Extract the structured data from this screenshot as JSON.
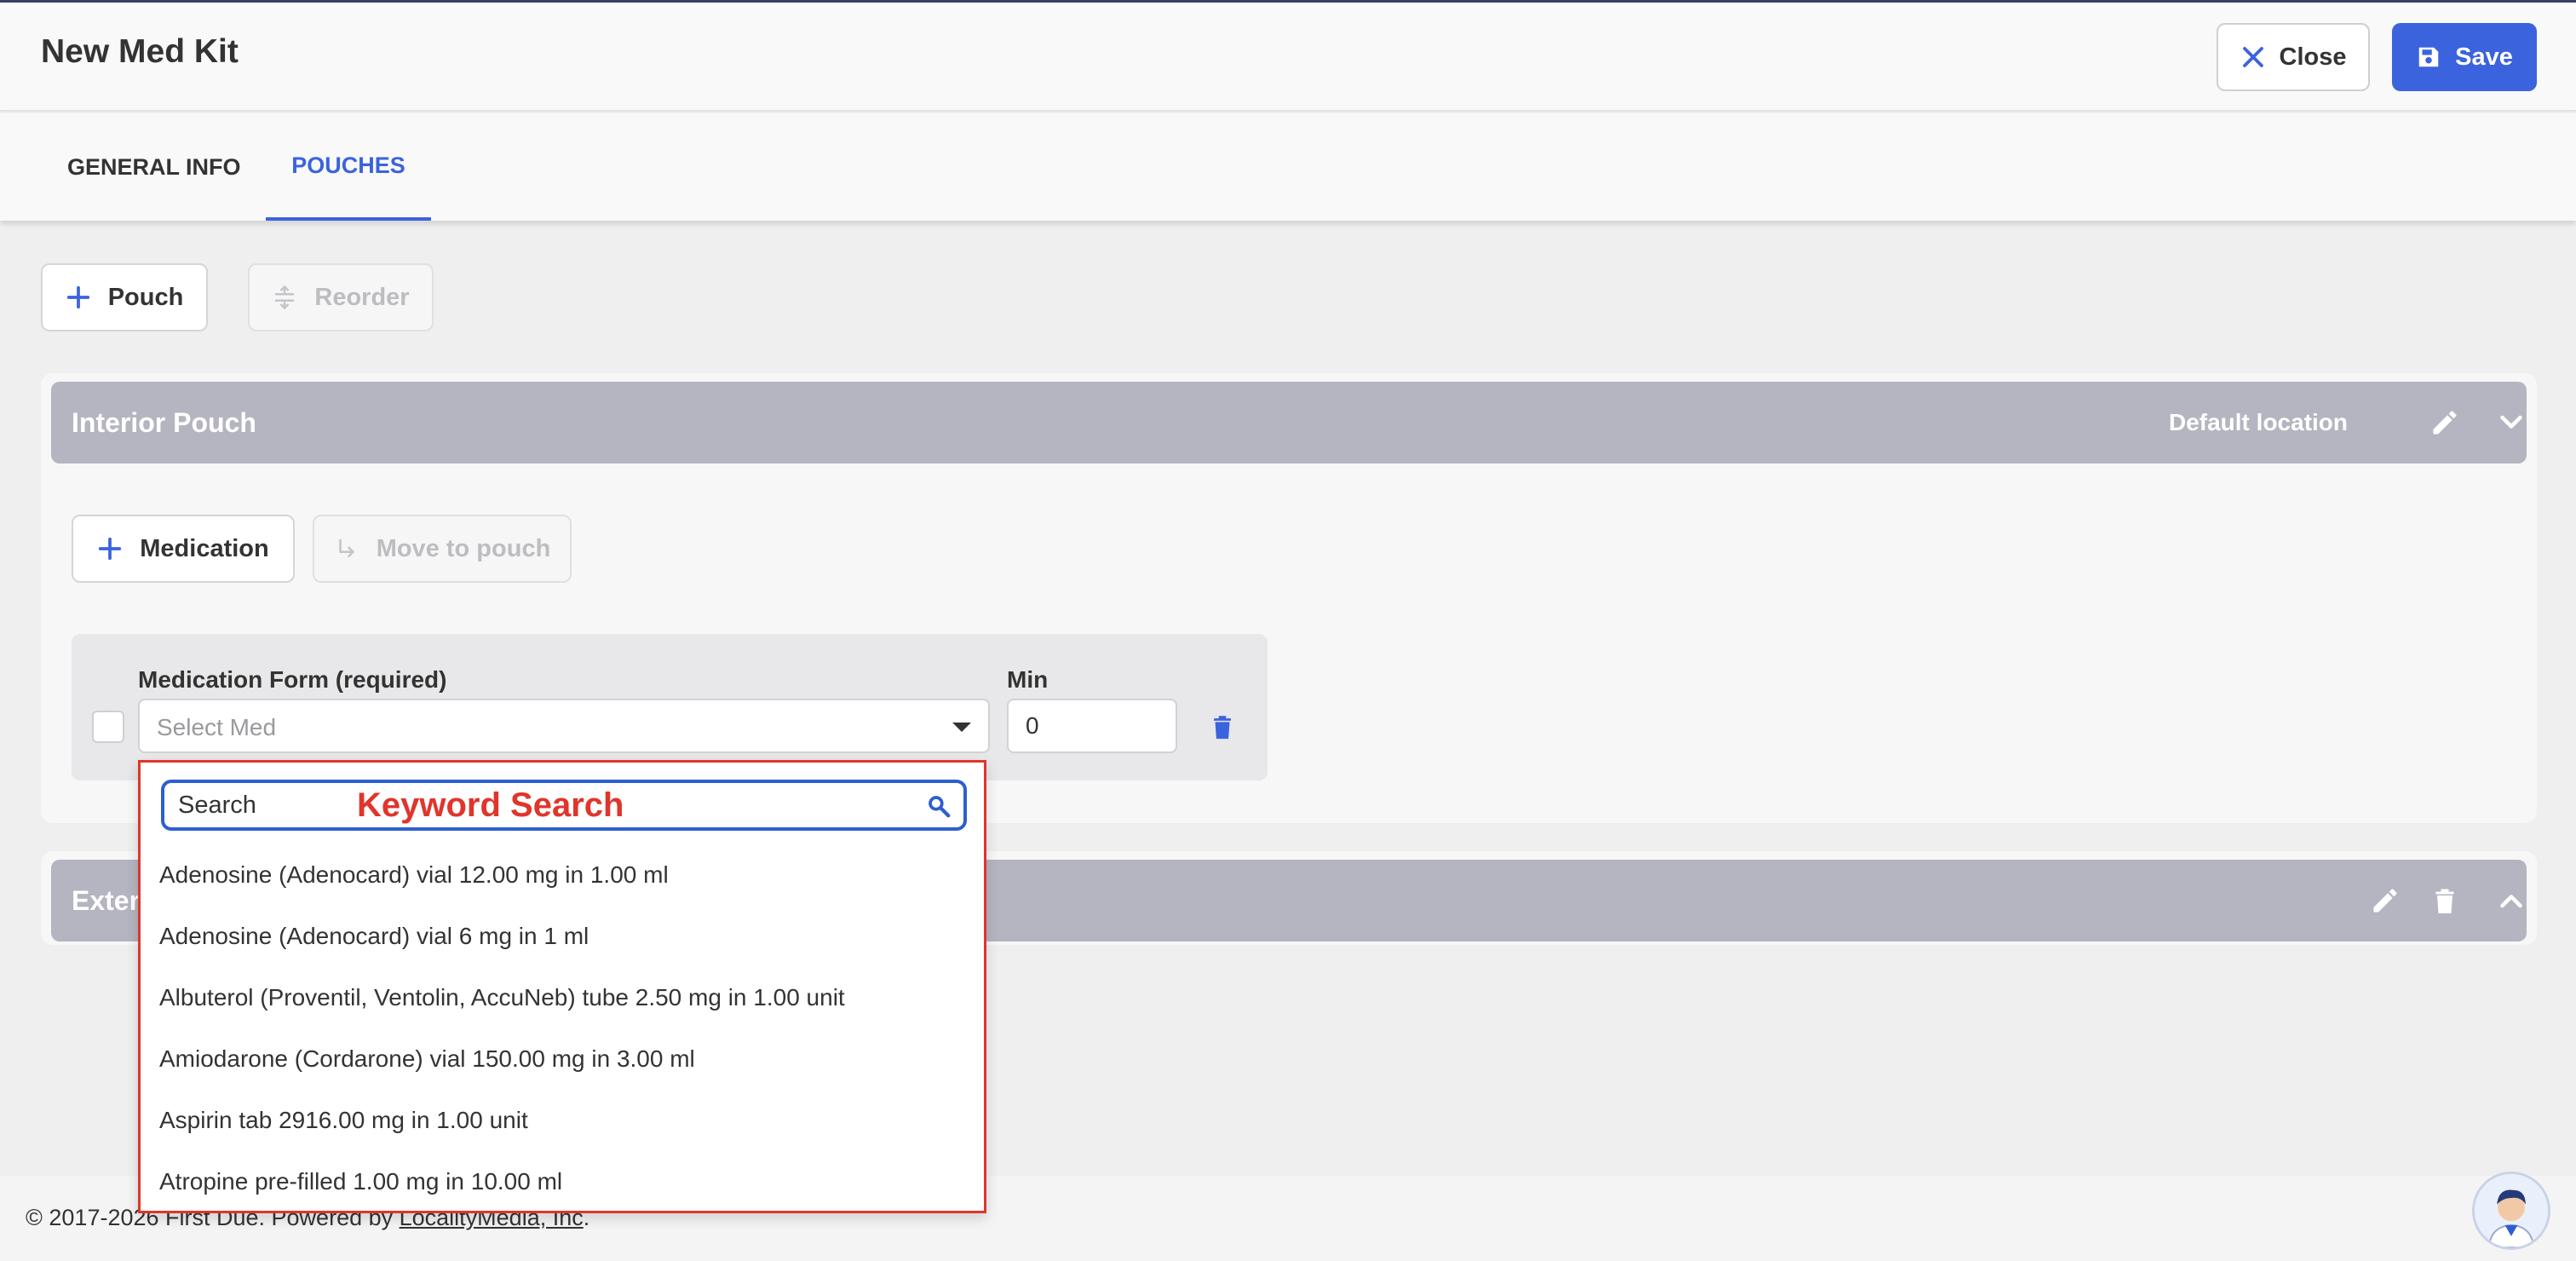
{
  "header": {
    "title": "New Med Kit",
    "close_label": "Close",
    "save_label": "Save"
  },
  "tabs": [
    {
      "label": "GENERAL INFO",
      "active": false
    },
    {
      "label": "POUCHES",
      "active": true
    }
  ],
  "toolbar": {
    "pouch_label": "Pouch",
    "reorder_label": "Reorder"
  },
  "interior_pouch": {
    "title": "Interior Pouch",
    "location": "Default location",
    "medication_label": "Medication",
    "move_label": "Move to pouch",
    "row": {
      "form_label": "Medication Form (required)",
      "select_placeholder": "Select Med",
      "min_label": "Min",
      "min_value": "0"
    }
  },
  "exterior_pouch": {
    "title": "Exter"
  },
  "dropdown": {
    "search_placeholder": "Search",
    "annotation": "Keyword Search",
    "options": [
      "Adenosine (Adenocard) vial 12.00 mg in 1.00 ml",
      "Adenosine (Adenocard) vial 6 mg in 1 ml",
      "Albuterol (Proventil, Ventolin, AccuNeb) tube 2.50 mg in 1.00 unit",
      "Amiodarone (Cordarone) vial 150.00 mg in 3.00 ml",
      "Aspirin tab 2916.00 mg in 1.00 unit",
      "Atropine pre-filled 1.00 mg in 10.00 ml"
    ]
  },
  "footer": {
    "copyright": "© 2017-2026 First Due. Powered by ",
    "link": "LocalityMedia, Inc",
    "suffix": "."
  },
  "colors": {
    "accent": "#3b63dd",
    "annotation": "#e0352b",
    "pouch_header": "#b4b5c0"
  }
}
